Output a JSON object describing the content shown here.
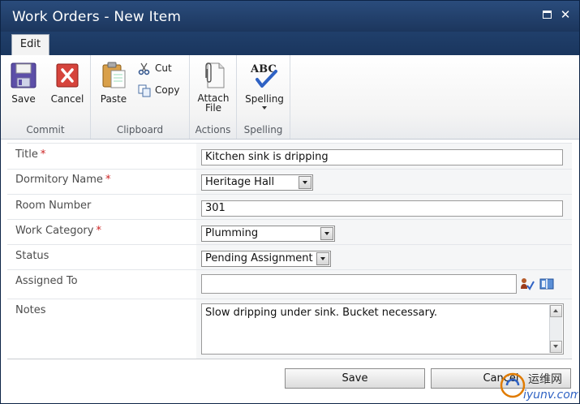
{
  "window": {
    "title": "Work Orders - New Item"
  },
  "tabs": [
    {
      "label": "Edit"
    }
  ],
  "ribbon": {
    "commit": {
      "label": "Commit",
      "save": "Save",
      "cancel": "Cancel"
    },
    "clipboard": {
      "label": "Clipboard",
      "paste": "Paste",
      "cut": "Cut",
      "copy": "Copy"
    },
    "actions": {
      "label": "Actions",
      "attach_line1": "Attach",
      "attach_line2": "File"
    },
    "spelling": {
      "label": "Spelling",
      "spelling": "Spelling",
      "abc": "ABC"
    }
  },
  "form": {
    "title": {
      "label": "Title",
      "required": "*",
      "value": "Kitchen sink is dripping"
    },
    "dormitory": {
      "label": "Dormitory Name",
      "required": "*",
      "value": "Heritage Hall"
    },
    "room": {
      "label": "Room Number",
      "value": "301"
    },
    "category": {
      "label": "Work Category",
      "required": "*",
      "value": "Plumming"
    },
    "status": {
      "label": "Status",
      "value": "Pending Assignment"
    },
    "assigned": {
      "label": "Assigned To",
      "value": ""
    },
    "notes": {
      "label": "Notes",
      "value": "Slow dripping under sink. Bucket necessary."
    }
  },
  "buttons": {
    "save": "Save",
    "cancel": "Cancel"
  },
  "watermark": {
    "text": "运维网",
    "sub": "iyunv.com"
  },
  "colors": {
    "titlebar": "#1c365d",
    "required": "#cc2222",
    "accent": "#e07b00"
  }
}
